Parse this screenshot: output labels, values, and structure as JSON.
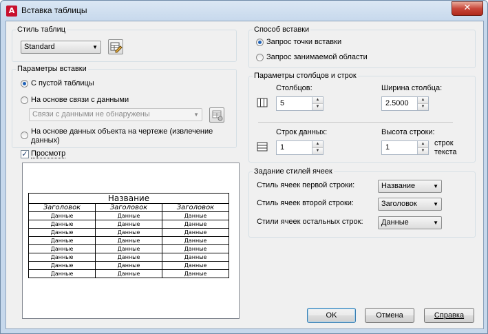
{
  "window": {
    "title": "Вставка таблицы",
    "close_glyph": "✕"
  },
  "table_style": {
    "group_label": "Стиль таблиц",
    "selected": "Standard"
  },
  "insert_params": {
    "group_label": "Параметры вставки",
    "options": [
      {
        "label": "С пустой таблицы",
        "checked": true
      },
      {
        "label": "На основе связи с данными",
        "checked": false
      },
      {
        "label": "На основе данных объекта на чертеже (извлечение данных)",
        "checked": false
      }
    ],
    "link_combo": "Связи с данными не обнаружены"
  },
  "preview": {
    "checkbox_label": "Просмотр",
    "checked": true,
    "table_title": "Название",
    "headers": [
      "Заголовок",
      "Заголовок",
      "Заголовок"
    ],
    "rows": [
      [
        "Данные",
        "Данные",
        "Данные"
      ],
      [
        "Данные",
        "Данные",
        "Данные"
      ],
      [
        "Данные",
        "Данные",
        "Данные"
      ],
      [
        "Данные",
        "Данные",
        "Данные"
      ],
      [
        "Данные",
        "Данные",
        "Данные"
      ],
      [
        "Данные",
        "Данные",
        "Данные"
      ],
      [
        "Данные",
        "Данные",
        "Данные"
      ],
      [
        "Данные",
        "Данные",
        "Данные"
      ]
    ]
  },
  "insert_method": {
    "group_label": "Способ вставки",
    "options": [
      {
        "label": "Запрос точки вставки",
        "checked": true
      },
      {
        "label": "Запрос занимаемой области",
        "checked": false
      }
    ]
  },
  "cols_rows": {
    "group_label": "Параметры столбцов и строк",
    "columns_label": "Столбцов:",
    "columns_value": "5",
    "col_width_label": "Ширина столбца:",
    "col_width_value": "2.5000",
    "data_rows_label": "Строк данных:",
    "data_rows_value": "1",
    "row_height_label": "Высота строки:",
    "row_height_value": "1",
    "row_height_unit": "строк текста"
  },
  "cell_styles": {
    "group_label": "Задание стилей ячеек",
    "first_row_label": "Стиль ячеек первой строки:",
    "first_row_value": "Название",
    "second_row_label": "Стиль ячеек второй строки:",
    "second_row_value": "Заголовок",
    "other_rows_label": "Стили ячеек остальных строк:",
    "other_rows_value": "Данные"
  },
  "buttons": {
    "ok": "OK",
    "cancel": "Отмена",
    "help": "Справка"
  }
}
